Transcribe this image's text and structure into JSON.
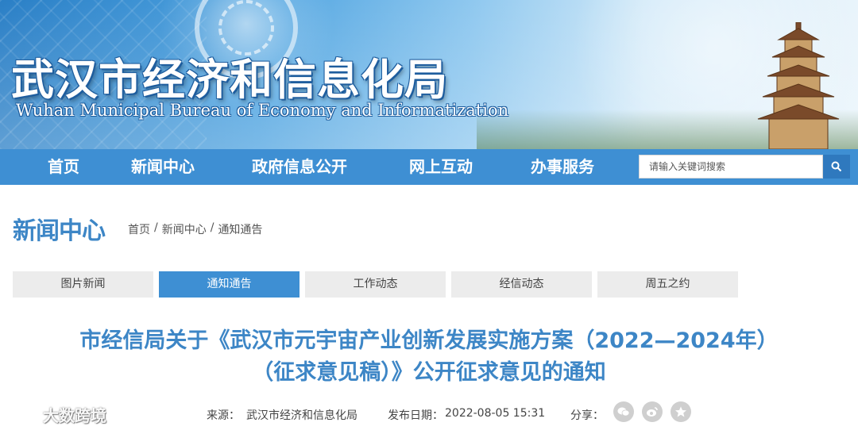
{
  "banner": {
    "title_cn": "武汉市经济和信息化局",
    "title_en": "Wuhan Municipal Bureau of Economy and Informatization"
  },
  "nav": {
    "items": [
      "首页",
      "新闻中心",
      "政府信息公开",
      "网上互动",
      "办事服务"
    ],
    "search_placeholder": "请输入关键词搜索"
  },
  "page": {
    "title": "新闻中心",
    "breadcrumb": [
      "首页",
      "新闻中心",
      "通知通告"
    ]
  },
  "tabs": [
    {
      "label": "图片新闻",
      "active": false
    },
    {
      "label": "通知通告",
      "active": true
    },
    {
      "label": "工作动态",
      "active": false
    },
    {
      "label": "经信动态",
      "active": false
    },
    {
      "label": "周五之约",
      "active": false
    }
  ],
  "article": {
    "title_line1": "市经信局关于《武汉市元宇宙产业创新发展实施方案（2022—2024年）",
    "title_line2": "（征求意见稿）》公开征求意见的通知",
    "source_label": "来源：",
    "source": "武汉市经济和信息化局",
    "date_label": "发布日期：",
    "date": "2022-08-05 15:31",
    "share_label": "分享：",
    "share_icons": [
      "wechat-icon",
      "weibo-icon",
      "favorite-icon"
    ]
  },
  "watermark": {
    "text": "大数跨境"
  },
  "colors": {
    "nav_bg": "#3e8fd3",
    "accent": "#3d86c6",
    "tab_bg": "#ececec"
  }
}
